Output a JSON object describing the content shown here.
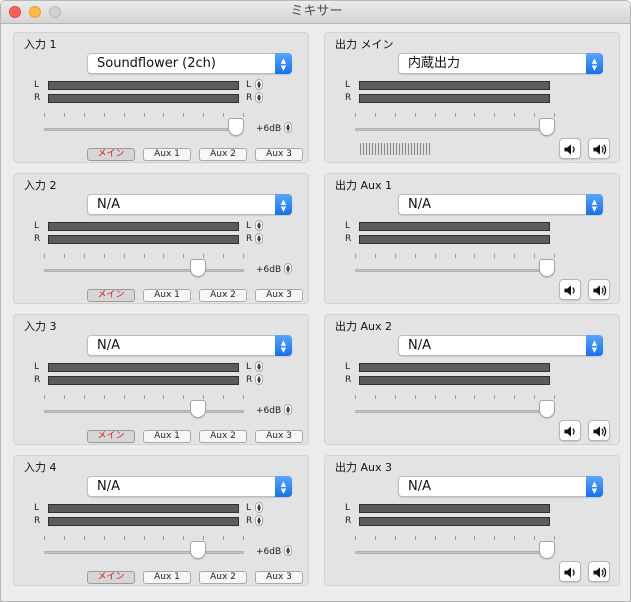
{
  "window": {
    "title": "ミキサー"
  },
  "channel_labels": {
    "left": "L",
    "right": "R"
  },
  "colors": {
    "accent": "#1a7cf5",
    "active_route_text": "#d51a1a",
    "meter": "#5c5c5c"
  },
  "inputs": [
    {
      "title": "入力 1",
      "device": "Soundflower (2ch)",
      "gain": "+6dB",
      "fader_level": 1.0,
      "routes": [
        {
          "label": "メイン",
          "active": true
        },
        {
          "label": "Aux 1",
          "active": false
        },
        {
          "label": "Aux 2",
          "active": false
        },
        {
          "label": "Aux 3",
          "active": false
        }
      ]
    },
    {
      "title": "入力 2",
      "device": "N/A",
      "gain": "+6dB",
      "fader_level": 0.8,
      "routes": [
        {
          "label": "メイン",
          "active": true
        },
        {
          "label": "Aux 1",
          "active": false
        },
        {
          "label": "Aux 2",
          "active": false
        },
        {
          "label": "Aux 3",
          "active": false
        }
      ]
    },
    {
      "title": "入力 3",
      "device": "N/A",
      "gain": "+6dB",
      "fader_level": 0.8,
      "routes": [
        {
          "label": "メイン",
          "active": true
        },
        {
          "label": "Aux 1",
          "active": false
        },
        {
          "label": "Aux 2",
          "active": false
        },
        {
          "label": "Aux 3",
          "active": false
        }
      ]
    },
    {
      "title": "入力 4",
      "device": "N/A",
      "gain": "+6dB",
      "fader_level": 0.8,
      "routes": [
        {
          "label": "メイン",
          "active": true
        },
        {
          "label": "Aux 1",
          "active": false
        },
        {
          "label": "Aux 2",
          "active": false
        },
        {
          "label": "Aux 3",
          "active": false
        }
      ]
    }
  ],
  "outputs": [
    {
      "title": "出力 メイン",
      "device": "内蔵出力",
      "fader_level": 1.0,
      "has_level_bar": true
    },
    {
      "title": "出力 Aux 1",
      "device": "N/A",
      "fader_level": 1.0,
      "has_level_bar": false
    },
    {
      "title": "出力 Aux 2",
      "device": "N/A",
      "fader_level": 1.0,
      "has_level_bar": false
    },
    {
      "title": "出力 Aux 3",
      "device": "N/A",
      "fader_level": 1.0,
      "has_level_bar": false
    }
  ]
}
